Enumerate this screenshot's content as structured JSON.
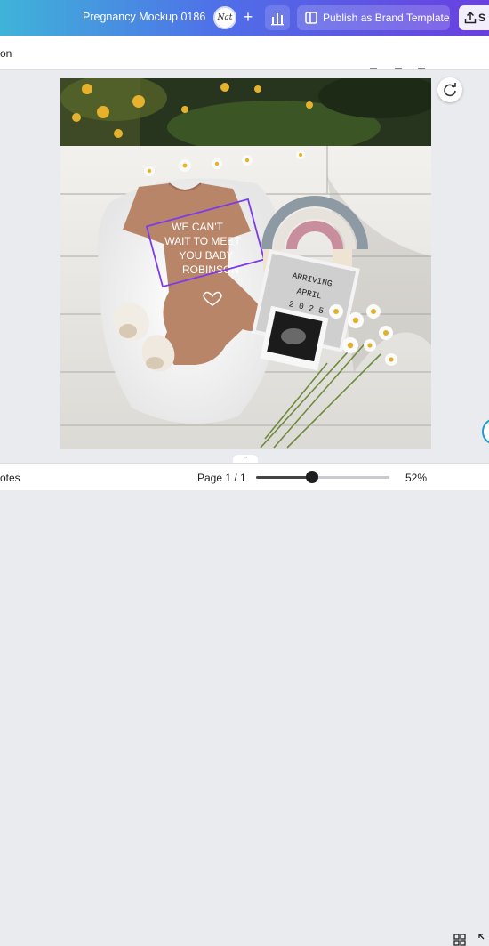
{
  "header": {
    "doc_title": "Pregnancy Mockup 0186",
    "avatar_initials": "Nat",
    "publish_label": "Publish as Brand Template",
    "share_label": "S"
  },
  "toolbar": {
    "partial_label": "on"
  },
  "design": {
    "onesie_text": [
      "WE CAN'T",
      "WAIT TO MEET",
      "YOU BABY",
      "ROBINSON"
    ],
    "board_text": [
      "ARRIVING",
      "APRIL",
      "2 0 2 5"
    ]
  },
  "footer": {
    "notes_label": "otes",
    "page_indicator": "Page 1 / 1",
    "zoom_level": "52%",
    "zoom_value": 0.42
  },
  "colors": {
    "accent": "#6a3fe0",
    "selection": "#7c3aed"
  }
}
